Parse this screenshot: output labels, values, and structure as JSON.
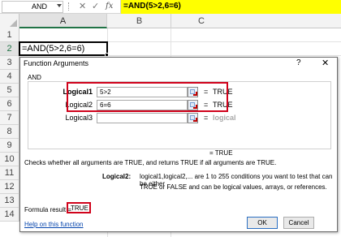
{
  "formula_bar": {
    "name_box": "AND",
    "cancel_icon": "✕",
    "enter_icon": "✓",
    "fx_icon": "fx",
    "formula": "=AND(5>2,6=6)"
  },
  "grid": {
    "columns": [
      "A",
      "B",
      "C"
    ],
    "rows": [
      "1",
      "2",
      "3",
      "4",
      "5",
      "6",
      "7",
      "8",
      "9",
      "10",
      "11",
      "12",
      "13",
      "14"
    ],
    "active_cell_text": "=AND(5>2,6=6)"
  },
  "dialog": {
    "title": "Function Arguments",
    "help_icon": "?",
    "close_icon": "✕",
    "function_name": "AND",
    "args": [
      {
        "label": "Logical1",
        "value": "5>2",
        "result": "TRUE"
      },
      {
        "label": "Logical2",
        "value": "6=6",
        "result": "TRUE"
      },
      {
        "label": "Logical3",
        "value": "",
        "result": "logical"
      }
    ],
    "equals": "=",
    "overall_result": "= TRUE",
    "description": "Checks whether all arguments are TRUE, and returns TRUE if all arguments are TRUE.",
    "arg_desc_label": "Logical2:",
    "arg_desc_line1": "logical1,logical2,... are 1 to 255 conditions you want to test that can be either",
    "arg_desc_line2": "TRUE or FALSE and can be logical values, arrays, or references.",
    "formula_result_label": "Formula result =",
    "formula_result": "TRUE",
    "help_link": "Help on this function",
    "ok": "OK",
    "cancel": "Cancel"
  },
  "colors": {
    "highlight": "#ffff00",
    "annotation": "#d0021b",
    "excel_green": "#217346"
  }
}
